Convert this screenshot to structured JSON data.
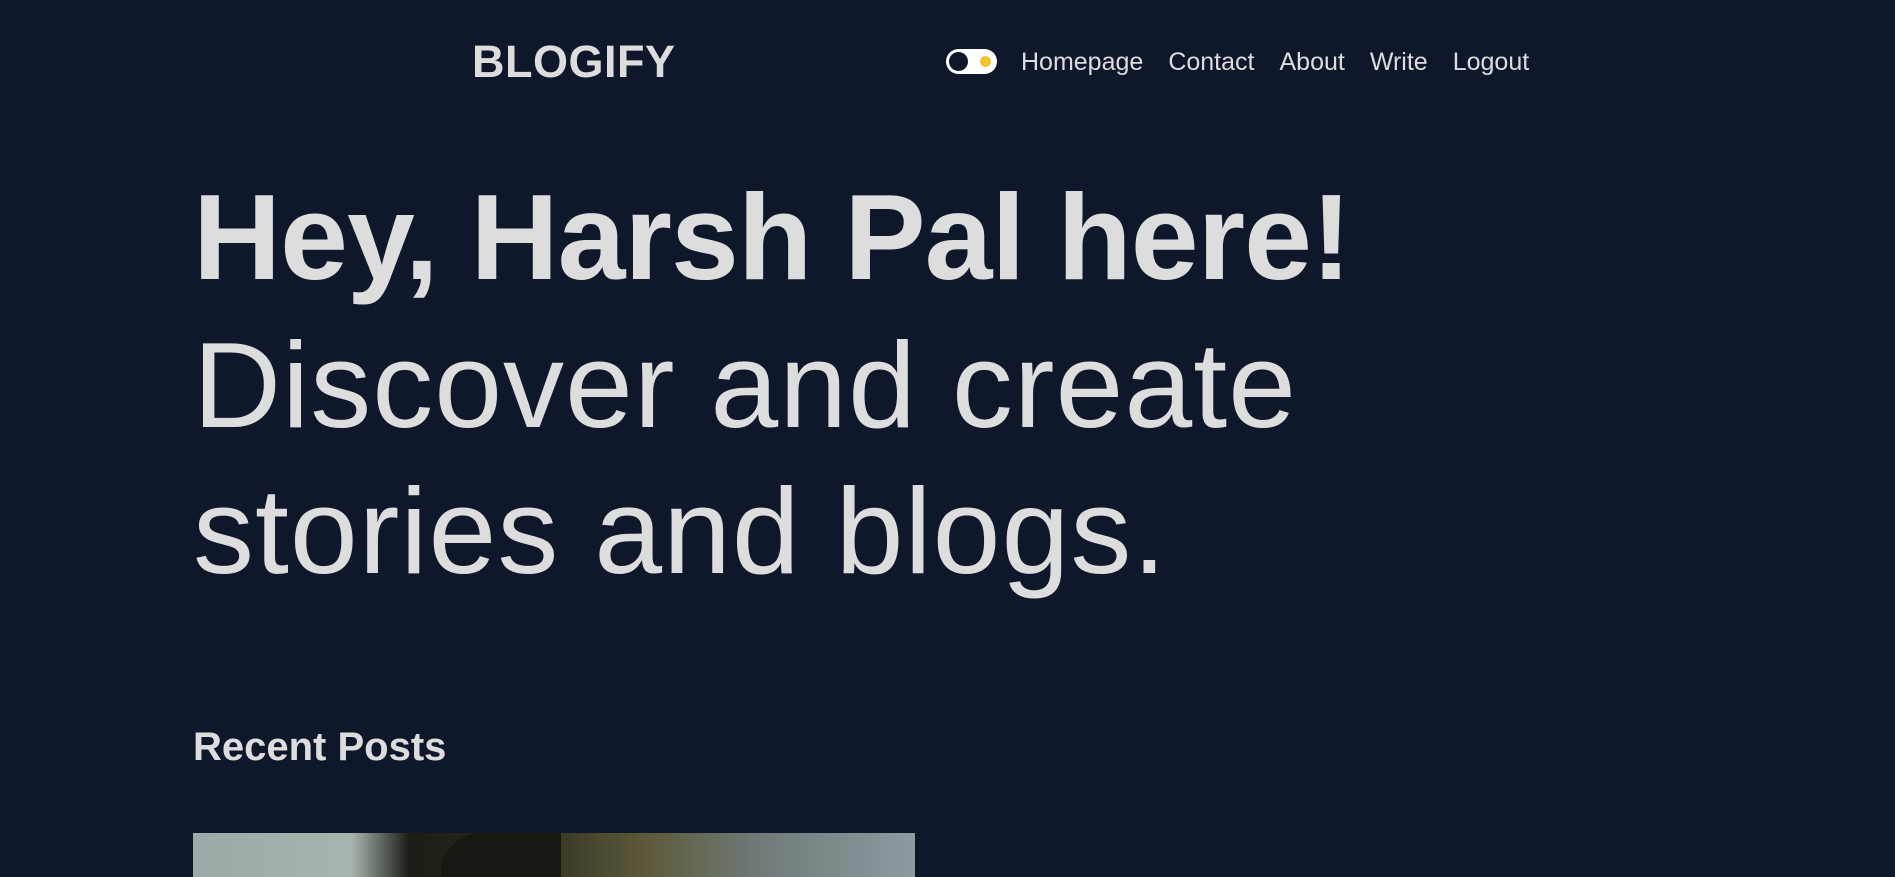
{
  "navbar": {
    "logo": "BLOGIFY",
    "links": [
      {
        "label": "Homepage"
      },
      {
        "label": "Contact"
      },
      {
        "label": "About"
      },
      {
        "label": "Write"
      },
      {
        "label": "Logout"
      }
    ],
    "theme_toggle": {
      "state": "dark"
    }
  },
  "hero": {
    "greeting": "Hey, Harsh Pal here!",
    "tagline": "Discover and create stories and blogs."
  },
  "recent_posts": {
    "title": "Recent Posts"
  },
  "colors": {
    "background": "#0f172a",
    "text": "#dddddd",
    "toggle_background": "#ffffff",
    "toggle_sun": "#f4c430"
  }
}
